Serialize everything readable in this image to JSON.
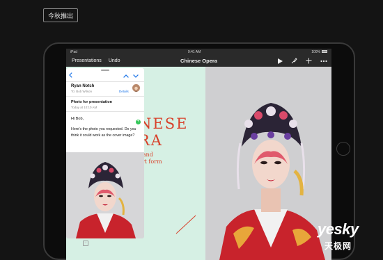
{
  "promo_badge": "今秋推出",
  "status_bar": {
    "carrier": "iPad",
    "time": "9:41 AM",
    "battery": "100%"
  },
  "toolbar": {
    "presentations_label": "Presentations",
    "undo_label": "Undo",
    "title": "Chinese Opera",
    "icons": [
      "play-icon",
      "format-brush-icon",
      "add-icon",
      "more-icon"
    ]
  },
  "slide": {
    "headline_line1": "NESE",
    "headline_line2": "RA",
    "sub_line1": "t and",
    "sub_line2": "art form",
    "accent_color": "#d8402a",
    "background_color": "#d6f0e4"
  },
  "mail": {
    "from": "Ryan Notch",
    "to": "To: Bob Wilson",
    "details_label": "Details",
    "subject": "Photo for presentation",
    "date": "Today at 10:10 AM",
    "greeting": "Hi Bob,",
    "body": "Here's the photo you requested. Do you think it could work as the cover image?",
    "toolbar_icons": [
      "flag-icon",
      "folder-icon",
      "trash-icon",
      "reply-icon",
      "compose-icon"
    ],
    "link_color": "#1a73e8"
  },
  "watermark": {
    "brand": "yesky",
    "cn": "天极网"
  }
}
